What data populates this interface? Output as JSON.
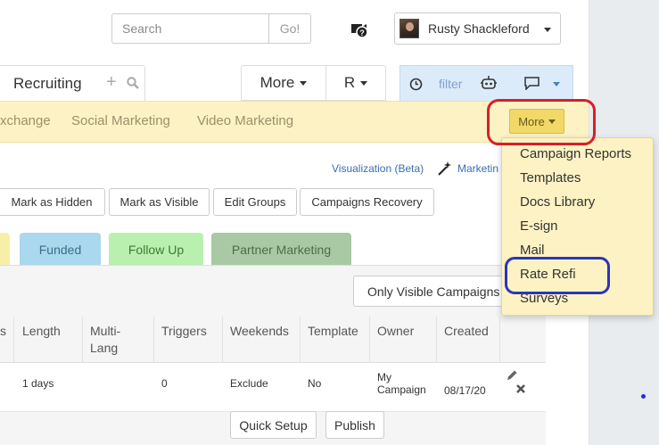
{
  "header": {
    "search_placeholder": "Search",
    "go_label": "Go!",
    "user_name": "Rusty Shackleford"
  },
  "tabs": {
    "active_label": "Recruiting",
    "more_label": "More",
    "r_label": "R",
    "filter_label": "filter"
  },
  "nav": {
    "items": [
      "xchange",
      "Social Marketing",
      "Video Marketing"
    ],
    "more_button_label": "More"
  },
  "more_dropdown": {
    "items": [
      "Campaign Reports",
      "Templates",
      "Docs Library",
      "E-sign",
      "Mail",
      "Rate Refi",
      "Surveys"
    ]
  },
  "links": {
    "visualization": "Visualization (Beta)",
    "marketing": "Marketin"
  },
  "actions": {
    "buttons": [
      "Mark as Hidden",
      "Mark as Visible",
      "Edit Groups",
      "Campaigns Recovery"
    ]
  },
  "pills": [
    {
      "label": "",
      "bg": "#f7efa8",
      "color": "#8a7f3a"
    },
    {
      "label": "Funded",
      "bg": "#a9d8ef",
      "color": "#3a6f8a"
    },
    {
      "label": "Follow Up",
      "bg": "#b9f0b0",
      "color": "#3f7a35"
    },
    {
      "label": "Partner Marketing",
      "bg": "#a9c9a4",
      "color": "#4f6b4a"
    }
  ],
  "table": {
    "only_visible_label": "Only Visible Campaigns",
    "columns": [
      "s",
      "Length",
      "Multi-Lang",
      "Triggers",
      "Weekends",
      "Template",
      "Owner",
      "Created"
    ],
    "row": {
      "length": "1 days",
      "triggers": "0",
      "weekends": "Exclude",
      "template": "No",
      "owner": "My Campaign",
      "created": "08/17/20"
    },
    "row_actions": [
      "Quick Setup",
      "Publish"
    ]
  },
  "colors": {
    "nav_bg": "#fcf2c4",
    "more_button_bg": "#f2d869",
    "red_highlight": "#d81e27",
    "blue_highlight": "#2e35b6",
    "filter_bg": "#dcebfa",
    "link_blue": "#3b6db1"
  }
}
